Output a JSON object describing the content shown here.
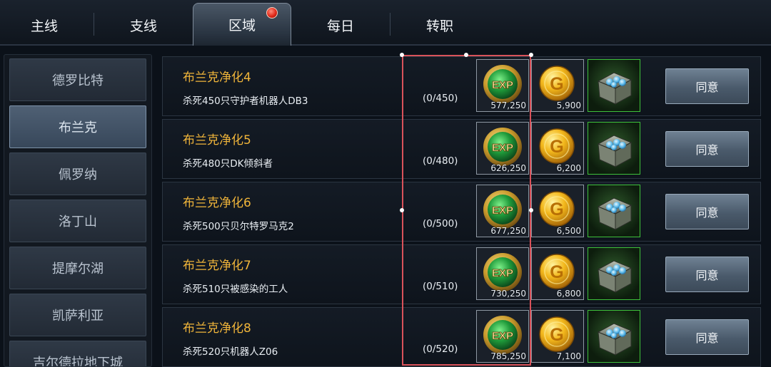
{
  "tabs": [
    {
      "label": "主线",
      "active": false
    },
    {
      "label": "支线",
      "active": false
    },
    {
      "label": "区域",
      "active": true,
      "has_notification": true
    },
    {
      "label": "每日",
      "active": false
    },
    {
      "label": "转职",
      "active": false
    }
  ],
  "sidebar": {
    "items": [
      {
        "label": "德罗比特",
        "active": false
      },
      {
        "label": "布兰克",
        "active": true
      },
      {
        "label": "佩罗纳",
        "active": false
      },
      {
        "label": "洛丁山",
        "active": false
      },
      {
        "label": "提摩尔湖",
        "active": false
      },
      {
        "label": "凯萨利亚",
        "active": false
      },
      {
        "label": "吉尔德拉地下城",
        "active": false
      }
    ]
  },
  "quests": [
    {
      "title": "布兰克净化4",
      "desc": "杀死450只守护者机器人DB3",
      "progress": "(0/450)",
      "exp": "577,250",
      "gold": "5,900",
      "accept_label": "同意"
    },
    {
      "title": "布兰克净化5",
      "desc": "杀死480只DK倾斜者",
      "progress": "(0/480)",
      "exp": "626,250",
      "gold": "6,200",
      "accept_label": "同意"
    },
    {
      "title": "布兰克净化6",
      "desc": "杀死500只贝尔特罗马克2",
      "progress": "(0/500)",
      "exp": "677,250",
      "gold": "6,500",
      "accept_label": "同意"
    },
    {
      "title": "布兰克净化7",
      "desc": "杀死510只被感染的工人",
      "progress": "(0/510)",
      "exp": "730,250",
      "gold": "6,800",
      "accept_label": "同意"
    },
    {
      "title": "布兰克净化8",
      "desc": "杀死520只机器人Z06",
      "progress": "(0/520)",
      "exp": "785,250",
      "gold": "7,100",
      "accept_label": "同意"
    }
  ],
  "icons": {
    "exp": "exp-orb-icon",
    "gold": "gold-coin-icon",
    "chest": "treasure-chest-icon"
  },
  "colors": {
    "quest_title": "#f0b53a",
    "selection": "#d9525a",
    "chest_border": "#3ec13a"
  }
}
